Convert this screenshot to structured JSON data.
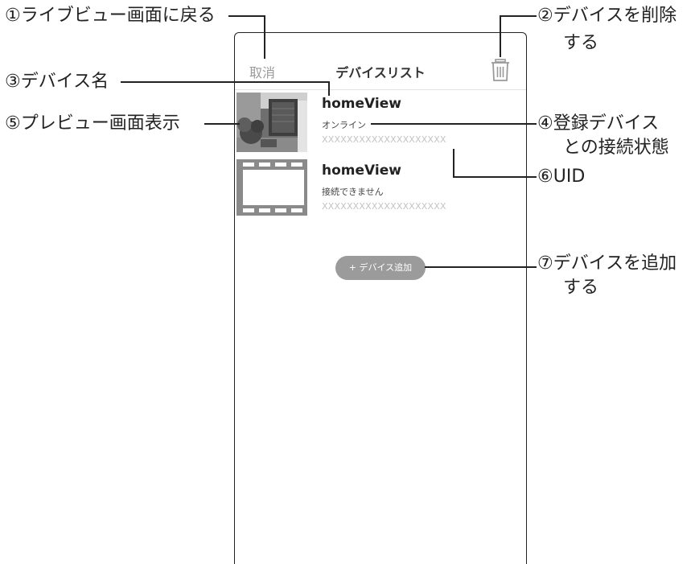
{
  "callouts": {
    "c1": "①ライブビュー画面に戻る",
    "c2_line1": "②デバイスを削除",
    "c2_line2": "する",
    "c3": "③デバイス名",
    "c4_line1": "④登録デバイス",
    "c4_line2": "との接続状態",
    "c5": "⑤プレビュー画面表示",
    "c6": "⑥UID",
    "c7_line1": "⑦デバイスを追加",
    "c7_line2": "する"
  },
  "navbar": {
    "cancel_label": "取消",
    "title": "デバイスリスト",
    "delete_icon": "trash-icon"
  },
  "devices": [
    {
      "name": "homeView",
      "status": "オンライン",
      "uid": "XXXXXXXXXXXXXXXXXXXX",
      "thumbnail": "camera-preview-image"
    },
    {
      "name": "homeView",
      "status": "接続できません",
      "uid": "XXXXXXXXXXXXXXXXXXXX",
      "thumbnail": "film-placeholder-icon"
    }
  ],
  "add_device_label": "+ デバイス追加",
  "colors": {
    "cancel_text": "#9a9a9a",
    "uid_text": "#c4c4c4",
    "add_button_bg": "#9b9b9b",
    "film_gray": "#8a8a8a"
  }
}
